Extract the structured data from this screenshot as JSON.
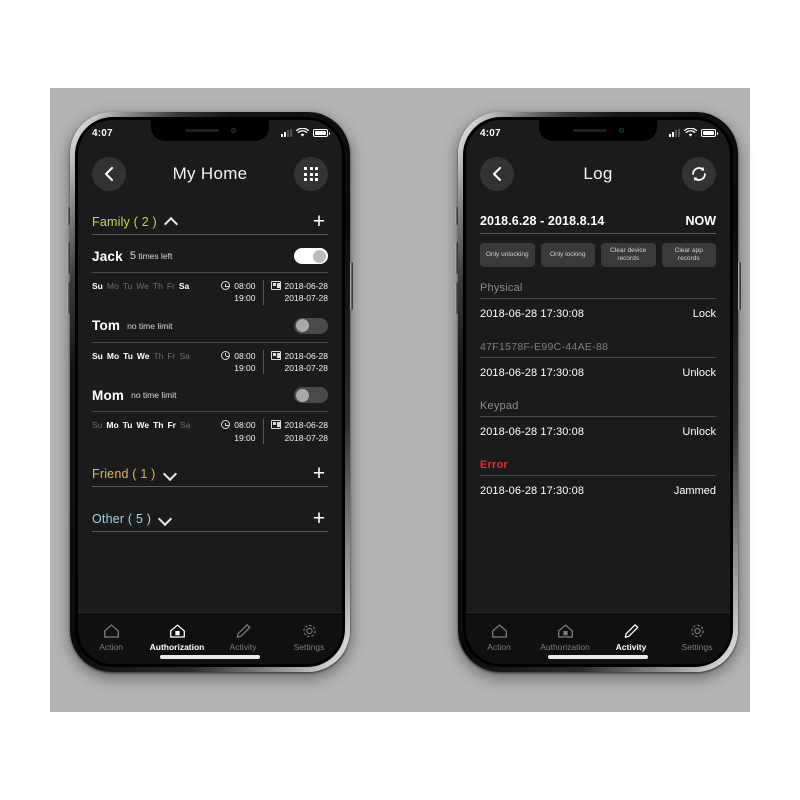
{
  "statusbar": {
    "time": "4:07",
    "signal_icon": "cellular-signal-icon",
    "wifi_icon": "wifi-icon",
    "battery_icon": "battery-icon"
  },
  "colors": {
    "family": "#c6d94a",
    "friend": "#e3b060",
    "other": "#9fd4e8",
    "error": "#e32b22",
    "screen_bg": "#1b1b1b",
    "backdrop": "#b4b4b4"
  },
  "left_phone": {
    "header": {
      "back_icon": "back-chevron-icon",
      "title": "My Home",
      "grid_icon": "grid-menu-icon"
    },
    "groups": [
      {
        "key": "family",
        "label": "Family ( 2 )",
        "expanded": true,
        "chevron": "chevron-up-icon",
        "add_label": "+"
      },
      {
        "key": "friend",
        "label": "Friend ( 1 )",
        "expanded": false,
        "chevron": "chevron-down-icon",
        "add_label": "+"
      },
      {
        "key": "other",
        "label": "Other ( 5 )",
        "expanded": false,
        "chevron": "chevron-down-icon",
        "add_label": "+"
      }
    ],
    "users": [
      {
        "name": "Jack",
        "limit_value": "5",
        "limit_text": "times left",
        "toggle_on": true,
        "days": [
          {
            "label": "Su",
            "active": true
          },
          {
            "label": "Mo",
            "active": false
          },
          {
            "label": "Tu",
            "active": false
          },
          {
            "label": "We",
            "active": false
          },
          {
            "label": "Th",
            "active": false
          },
          {
            "label": "Fr",
            "active": false
          },
          {
            "label": "Sa",
            "active": true
          }
        ],
        "time_start": "08:00",
        "time_end": "19:00",
        "date_start": "2018-06-28",
        "date_end": "2018-07-28"
      },
      {
        "name": "Tom",
        "limit_value": "",
        "limit_text": "no time limit",
        "toggle_on": false,
        "days": [
          {
            "label": "Su",
            "active": true
          },
          {
            "label": "Mo",
            "active": true
          },
          {
            "label": "Tu",
            "active": true
          },
          {
            "label": "We",
            "active": true
          },
          {
            "label": "Th",
            "active": false
          },
          {
            "label": "Fr",
            "active": false
          },
          {
            "label": "Sa",
            "active": false
          }
        ],
        "time_start": "08:00",
        "time_end": "19:00",
        "date_start": "2018-06-28",
        "date_end": "2018-07-28"
      },
      {
        "name": "Mom",
        "limit_value": "",
        "limit_text": "no time limit",
        "toggle_on": false,
        "days": [
          {
            "label": "Su",
            "active": false
          },
          {
            "label": "Mo",
            "active": true
          },
          {
            "label": "Tu",
            "active": true
          },
          {
            "label": "We",
            "active": true
          },
          {
            "label": "Th",
            "active": true
          },
          {
            "label": "Fr",
            "active": true
          },
          {
            "label": "Sa",
            "active": false
          }
        ],
        "time_start": "08:00",
        "time_end": "19:00",
        "date_start": "2018-06-28",
        "date_end": "2018-07-28"
      }
    ],
    "tabs": [
      {
        "label": "Action",
        "icon": "home-icon",
        "active": false
      },
      {
        "label": "Authorization",
        "icon": "home-key-icon",
        "active": true
      },
      {
        "label": "Activity",
        "icon": "pencil-icon",
        "active": false
      },
      {
        "label": "Settings",
        "icon": "gear-icon",
        "active": false
      }
    ]
  },
  "right_phone": {
    "header": {
      "back_icon": "back-chevron-icon",
      "title": "Log",
      "refresh_icon": "refresh-sync-icon"
    },
    "range": {
      "text": "2018.6.28 - 2018.8.14",
      "now_label": "NOW"
    },
    "filters": [
      {
        "label": "Only unlocking"
      },
      {
        "label": "Only locking"
      },
      {
        "label": "Clear device records"
      },
      {
        "label": "Clear app records"
      }
    ],
    "log_sections": [
      {
        "title": "Physical",
        "style": "normal",
        "entries": [
          {
            "time": "2018-06-28 17:30:08",
            "action": "Lock"
          }
        ]
      },
      {
        "title": "47F1578F-E99C-44AE-88",
        "style": "uuid",
        "entries": [
          {
            "time": "2018-06-28 17:30:08",
            "action": "Unlock"
          }
        ]
      },
      {
        "title": "Keypad",
        "style": "normal",
        "entries": [
          {
            "time": "2018-06-28 17:30:08",
            "action": "Unlock"
          }
        ]
      },
      {
        "title": "Error",
        "style": "error",
        "entries": [
          {
            "time": "2018-06-28 17:30:08",
            "action": "Jammed"
          }
        ]
      }
    ],
    "tabs": [
      {
        "label": "Action",
        "icon": "home-icon",
        "active": false
      },
      {
        "label": "Authorization",
        "icon": "home-key-icon",
        "active": false
      },
      {
        "label": "Activity",
        "icon": "pencil-icon",
        "active": true
      },
      {
        "label": "Settings",
        "icon": "gear-icon",
        "active": false
      }
    ]
  }
}
